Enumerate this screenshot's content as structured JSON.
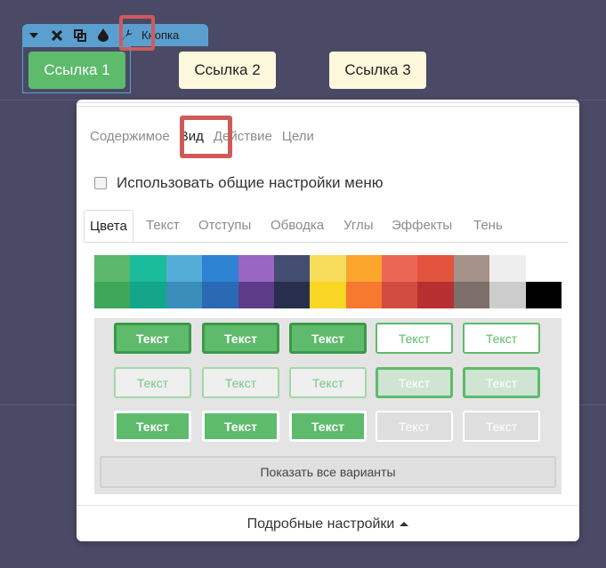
{
  "toolbar": {
    "label": "Кнопка",
    "icons": [
      "chevron-down-icon",
      "close-icon",
      "duplicate-icon",
      "droplet-icon",
      "wrench-icon"
    ]
  },
  "buttons": [
    "Ссылка 1",
    "Ссылка 2",
    "Ссылка 3"
  ],
  "panel": {
    "tabs": [
      "Содержимое",
      "Вид",
      "Действие",
      "Цели"
    ],
    "active_tab": "Вид",
    "checkbox_label": "Использовать общие настройки меню",
    "subtabs": [
      "Цвета",
      "Текст",
      "Отступы",
      "Обводка",
      "Углы",
      "Эффекты",
      "Тень"
    ],
    "active_subtab": "Цвета",
    "palette_top": [
      "#5cb86a",
      "#1abc9c",
      "#54add6",
      "#2d82d2",
      "#9966c1",
      "#434d71",
      "#f7dc5c",
      "#fba52c",
      "#ec6656",
      "#e2533e",
      "#a3918a",
      "#eeeeee",
      "#ffffff"
    ],
    "palette_bottom": [
      "#3ea75a",
      "#13a68a",
      "#3b8eb9",
      "#2a6ab5",
      "#5d3b89",
      "#282f4c",
      "#fad625",
      "#f7782f",
      "#d14d3f",
      "#b82f2f",
      "#7d6f69",
      "#cccccc",
      "#000000"
    ],
    "style_button_text": "Текст",
    "show_all": "Показать все варианты",
    "footer": "Подробные настройки"
  }
}
